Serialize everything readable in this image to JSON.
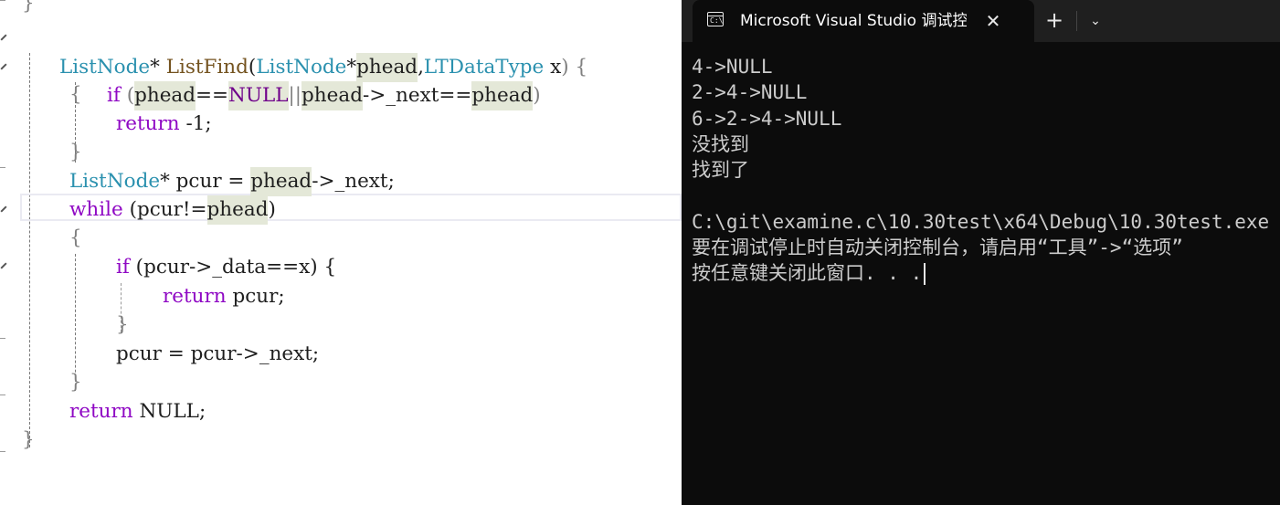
{
  "editor": {
    "function_signature": {
      "return_type": "ListNode",
      "star": "*",
      "space": " ",
      "name": "ListFind",
      "open": "(",
      "p1_type": "ListNode",
      "p1_star": "*",
      "p1_name": "phead",
      "comma": ",",
      "p2_type": "LTDataType",
      "p2_name": " x",
      "close_brace": ") {"
    },
    "if_line": {
      "kw": "if",
      "sp": " ",
      "open": "(",
      "a": "phead",
      "eq": "==",
      "null": "NULL",
      "or": "||",
      "b": "phead",
      "arrow_next": "->_next==",
      "c": "phead",
      "close": ")"
    },
    "open_brace": "{",
    "close_brace": "}",
    "return_neg": {
      "kw": "return",
      "val": " -1;"
    },
    "pcur_decl": {
      "type": "ListNode",
      "rest": "* pcur = ",
      "phead": "phead",
      "tail": "->_next;"
    },
    "while_line": {
      "kw": "while",
      "rest": " (pcur!=",
      "phead": "phead",
      "close": ")"
    },
    "inner_if": {
      "kw": "if",
      "rest": " (pcur->_data==x) {"
    },
    "return_pcur": {
      "kw": "return",
      "rest": " pcur;"
    },
    "advance": "pcur = pcur->_next;",
    "return_null": {
      "kw": "return",
      "rest": " NULL;"
    },
    "top_fragment": "}"
  },
  "console": {
    "tab_title": "Microsoft Visual Studio 调试控制台",
    "tab_icon_text": "C:\\",
    "close_label": "✕",
    "new_tab_label": "+",
    "dropdown_label": "⌄",
    "lines": [
      "4->NULL",
      "2->4->NULL",
      "6->2->4->NULL",
      "没找到",
      "找到了",
      "",
      "C:\\git\\examine.c\\10.30test\\x64\\Debug\\10.30test.exe",
      "要在调试停止时自动关闭控制台，请启用“工具”->“选项”",
      "按任意键关闭此窗口. . ."
    ]
  }
}
